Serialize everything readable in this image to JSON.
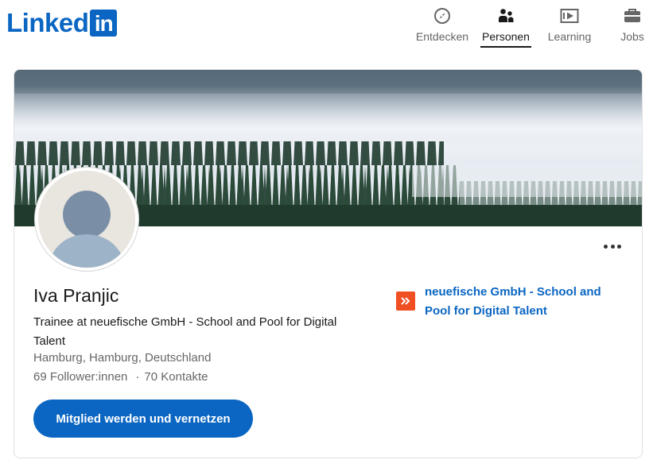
{
  "header": {
    "logo_text": "Linked",
    "logo_box_text": "in",
    "nav": [
      {
        "label": "Entdecken",
        "icon": "compass-icon"
      },
      {
        "label": "Personen",
        "icon": "people-icon",
        "active": true
      },
      {
        "label": "Learning",
        "icon": "learning-icon"
      },
      {
        "label": "Jobs",
        "icon": "briefcase-icon"
      }
    ]
  },
  "profile": {
    "name": "Iva Pranjic",
    "headline": "Trainee at neuefische GmbH - School and Pool for Digital Talent",
    "location": "Hamburg, Hamburg, Deutschland",
    "followers": "69 Follower:innen",
    "separator": "·",
    "connections": "70 Kontakte",
    "join_button": "Mitglied werden und vernetzen",
    "company": "neuefische GmbH - School and Pool for Digital Talent"
  },
  "colors": {
    "brand": "#0a66c2",
    "company_logo": "#f04e23",
    "text_primary": "#191919",
    "text_secondary": "#666666"
  }
}
